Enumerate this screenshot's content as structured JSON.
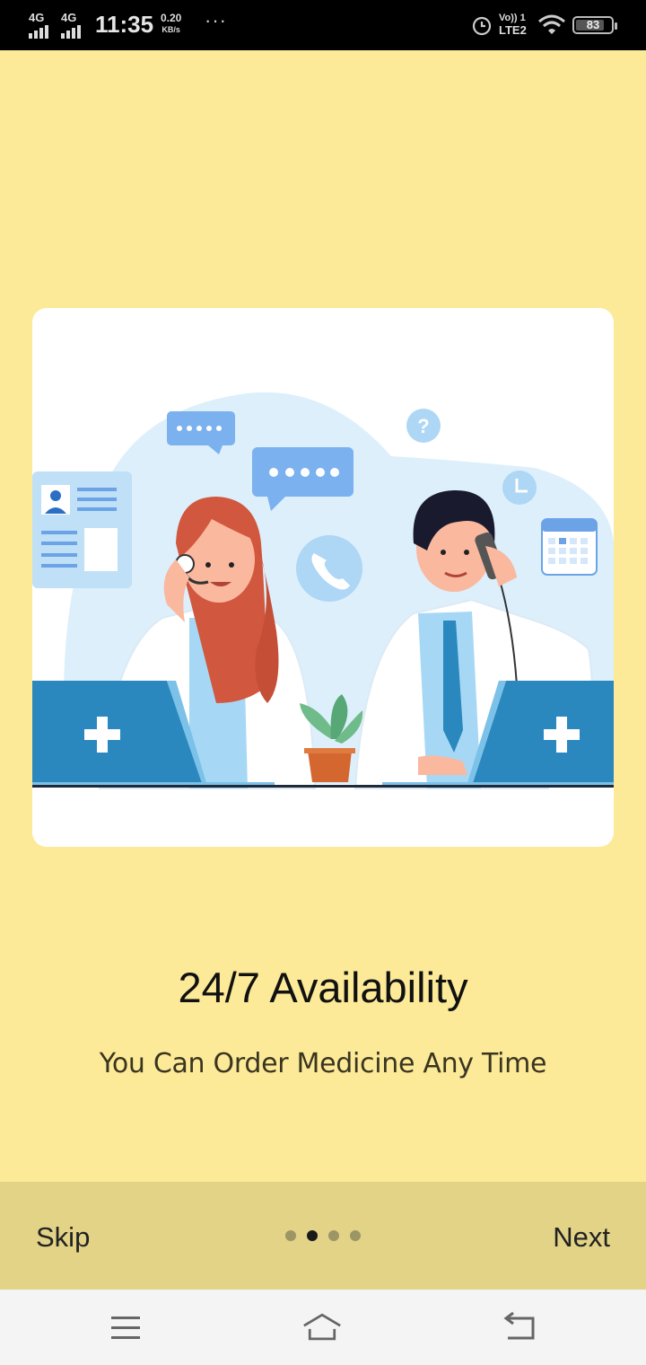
{
  "status_bar": {
    "network_1": "4G",
    "network_2": "4G",
    "time": "11:35",
    "speed_value": "0.20",
    "speed_unit": "KB/s",
    "more_dots": "···",
    "volte_line1": "Vo)) 1",
    "volte_line2": "LTE2",
    "battery_level": "83"
  },
  "onboarding": {
    "title": "24/7 Availability",
    "subtitle": "You Can Order Medicine Any Time",
    "page_count": 4,
    "active_page": 2
  },
  "bottom_bar": {
    "skip_label": "Skip",
    "next_label": "Next"
  },
  "nav_bar": {
    "icons": [
      "menu-icon",
      "home-icon",
      "back-icon"
    ]
  },
  "colors": {
    "background": "#FCEA98",
    "bottom_bar": "#E2D387",
    "accent_blue": "#2A88BF"
  }
}
